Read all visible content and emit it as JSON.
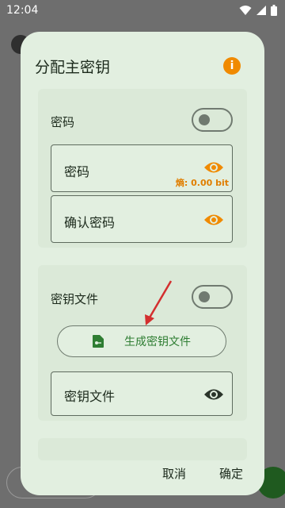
{
  "status_bar": {
    "time": "12:04",
    "icons": [
      "wifi-icon",
      "signal-icon",
      "battery-icon"
    ]
  },
  "dialog": {
    "title": "分配主密钥",
    "info_icon": "i",
    "password_section": {
      "toggle_label": "密码",
      "toggle_on": false,
      "password_field": {
        "label": "密码",
        "entropy": "熵: 0.00 bit"
      },
      "confirm_field": {
        "label": "确认密码"
      }
    },
    "keyfile_section": {
      "toggle_label": "密钥文件",
      "toggle_on": false,
      "generate_button": "生成密钥文件",
      "keyfile_field": {
        "label": "密钥文件"
      }
    },
    "buttons": {
      "cancel": "取消",
      "confirm": "确定"
    }
  },
  "colors": {
    "dialog_bg": "#e2efe0",
    "accent_orange": "#f08a00",
    "accent_green": "#2e7d32",
    "annotation_arrow": "#d32f2f"
  }
}
